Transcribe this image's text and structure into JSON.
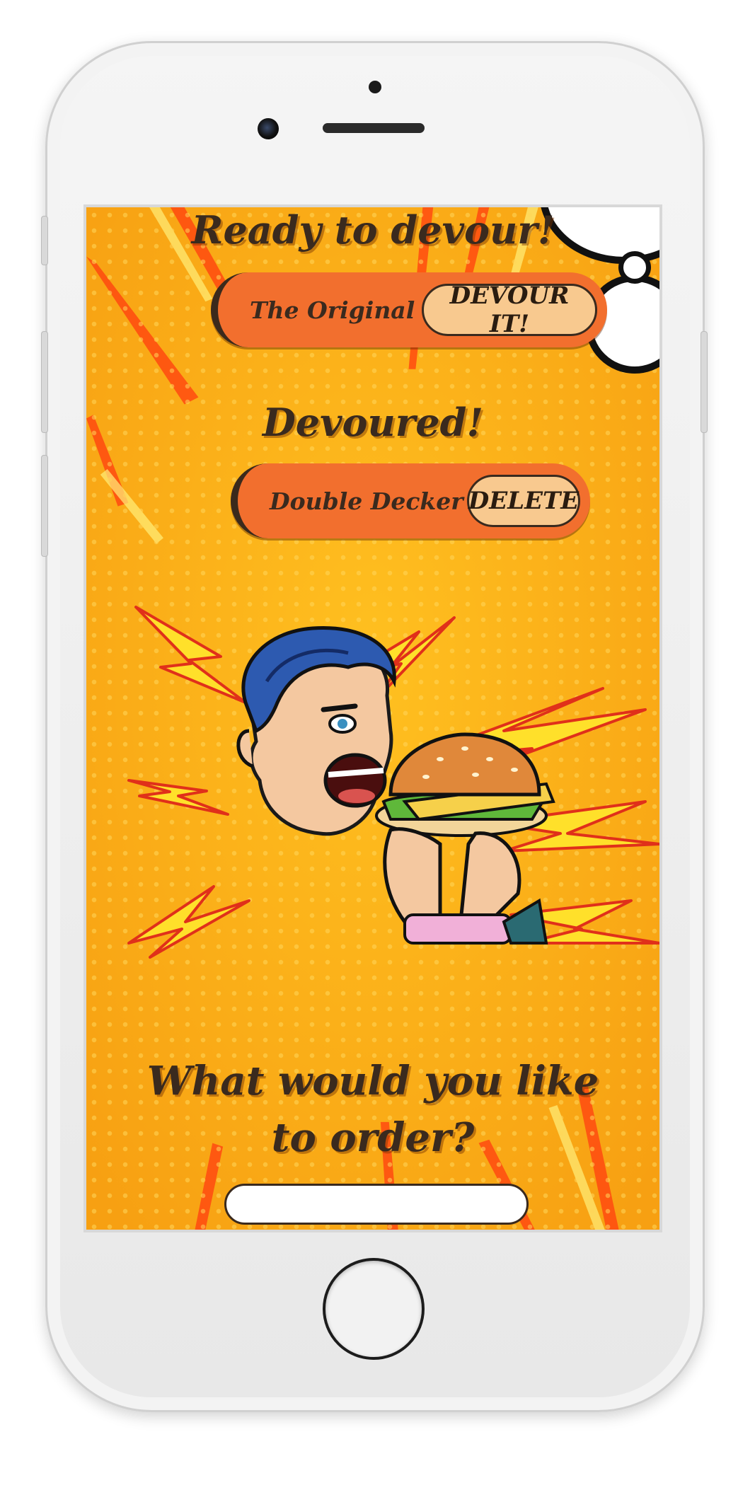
{
  "ready_section": {
    "heading": "Ready to devour!",
    "burgers": [
      {
        "name": "The Original",
        "action_label": "DEVOUR IT!"
      }
    ]
  },
  "devoured_section": {
    "heading": "Devoured!",
    "burgers": [
      {
        "name": "Double Decker",
        "action_label": "DELETE"
      }
    ]
  },
  "order_form": {
    "prompt": "What would you like to order?",
    "input_value": ""
  },
  "colors": {
    "background": "#f9a815",
    "pill": "#f26f2e",
    "button": "#f8c98f",
    "text": "#3a2a1e"
  }
}
